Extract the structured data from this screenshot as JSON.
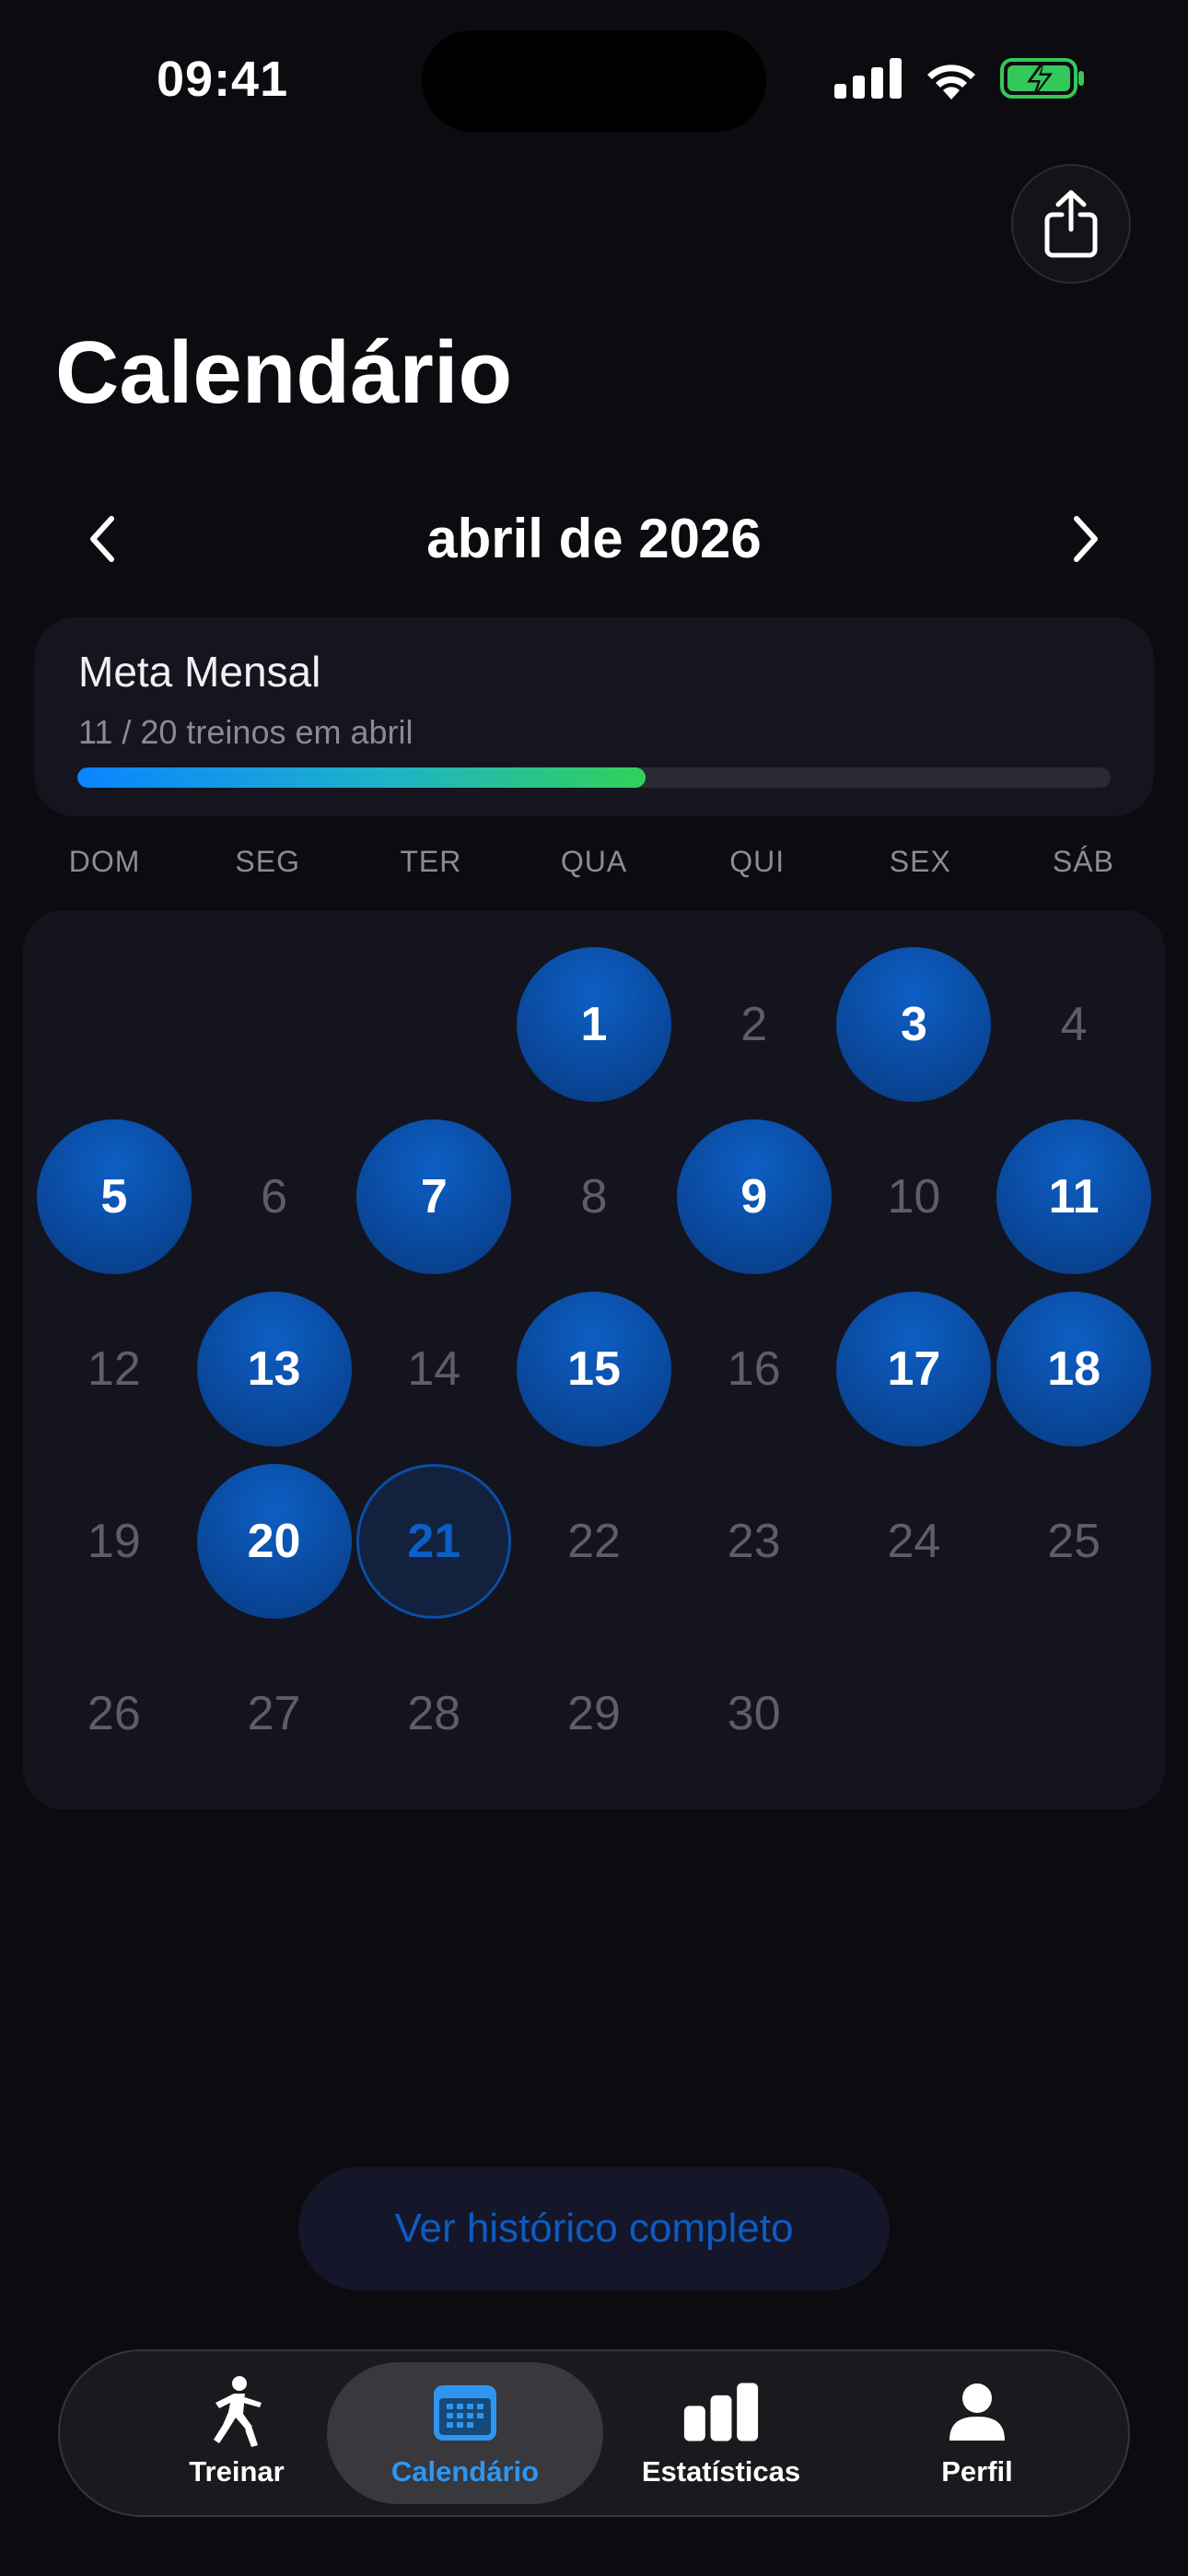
{
  "status_bar": {
    "time": "09:41"
  },
  "header": {
    "title": "Calendário"
  },
  "month_nav": {
    "label": "abril de 2026"
  },
  "goal": {
    "title": "Meta Mensal",
    "progress_text": "11 / 20 treinos em abril",
    "completed": 11,
    "target": 20,
    "progress_fraction": 0.55
  },
  "calendar": {
    "weekdays": [
      "DOM",
      "SEG",
      "TER",
      "QUA",
      "QUI",
      "SEX",
      "SÁB"
    ],
    "days": [
      {
        "label": "",
        "state": "empty"
      },
      {
        "label": "",
        "state": "empty"
      },
      {
        "label": "",
        "state": "empty"
      },
      {
        "label": "1",
        "state": "done"
      },
      {
        "label": "2",
        "state": "normal"
      },
      {
        "label": "3",
        "state": "done"
      },
      {
        "label": "4",
        "state": "normal"
      },
      {
        "label": "5",
        "state": "done"
      },
      {
        "label": "6",
        "state": "normal"
      },
      {
        "label": "7",
        "state": "done"
      },
      {
        "label": "8",
        "state": "normal"
      },
      {
        "label": "9",
        "state": "done"
      },
      {
        "label": "10",
        "state": "normal"
      },
      {
        "label": "11",
        "state": "done"
      },
      {
        "label": "12",
        "state": "normal"
      },
      {
        "label": "13",
        "state": "done"
      },
      {
        "label": "14",
        "state": "normal"
      },
      {
        "label": "15",
        "state": "done"
      },
      {
        "label": "16",
        "state": "normal"
      },
      {
        "label": "17",
        "state": "done"
      },
      {
        "label": "18",
        "state": "done"
      },
      {
        "label": "19",
        "state": "normal"
      },
      {
        "label": "20",
        "state": "done"
      },
      {
        "label": "21",
        "state": "today"
      },
      {
        "label": "22",
        "state": "normal"
      },
      {
        "label": "23",
        "state": "normal"
      },
      {
        "label": "24",
        "state": "normal"
      },
      {
        "label": "25",
        "state": "normal"
      },
      {
        "label": "26",
        "state": "normal"
      },
      {
        "label": "27",
        "state": "normal"
      },
      {
        "label": "28",
        "state": "normal"
      },
      {
        "label": "29",
        "state": "normal"
      },
      {
        "label": "30",
        "state": "normal"
      }
    ]
  },
  "history_button": {
    "label": "Ver histórico completo"
  },
  "tabs": [
    {
      "label": "Treinar",
      "icon": "runner-icon",
      "active": false
    },
    {
      "label": "Calendário",
      "icon": "calendar-icon",
      "active": true
    },
    {
      "label": "Estatísticas",
      "icon": "bar-chart-icon",
      "active": false
    },
    {
      "label": "Perfil",
      "icon": "person-icon",
      "active": false
    }
  ],
  "colors": {
    "background": "#0b0b10",
    "accent": "#0a4aa0",
    "tab_active": "#2e96f0",
    "progress_start": "#0a84ff",
    "progress_end": "#31d158",
    "battery": "#34c759"
  }
}
